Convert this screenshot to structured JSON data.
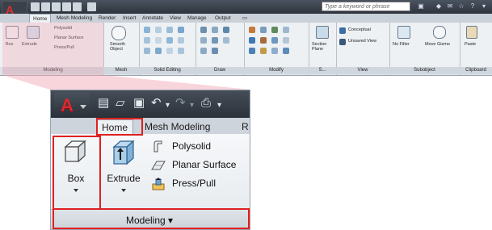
{
  "small_ribbon": {
    "search_placeholder": "Type a keyword or phrase",
    "tabs": [
      "Home",
      "Mesh Modeling",
      "Render",
      "Insert",
      "Annotate",
      "View",
      "Manage",
      "Output"
    ],
    "modeling": {
      "box": "Box",
      "extrude": "Extrude",
      "polysolid": "Polysolid",
      "planar": "Planar Surface",
      "presspull": "Press/Pull",
      "title": "Modeling"
    },
    "mesh": {
      "smooth": "Smooth Object",
      "title": "Mesh"
    },
    "solid_editing_title": "Solid Editing",
    "draw_title": "Draw",
    "modify_title": "Modify",
    "section": {
      "label": "Section Plane",
      "title": "S..."
    },
    "view": {
      "conceptual": "Conceptual",
      "unsaved": "Unsaved View",
      "title": "View"
    },
    "subobject": {
      "no_filter": "No Filter",
      "move_gizmo": "Move Gizmo",
      "title": "Subobject"
    },
    "clipboard": {
      "paste": "Paste",
      "title": "Clipboard"
    }
  },
  "zoom": {
    "tabs": {
      "home": "Home",
      "mesh": "Mesh Modeling",
      "third": "R"
    },
    "box_label": "Box",
    "extrude_label": "Extrude",
    "polysolid_label": "Polysolid",
    "planar_label": "Planar Surface",
    "presspull_label": "Press/Pull",
    "panel_title": "Modeling ▾"
  },
  "colors": {
    "highlight": "#e02020",
    "app_red": "#e0262f"
  },
  "icons": [
    "app-menu-icon",
    "new-icon",
    "open-icon",
    "save-icon",
    "undo-icon",
    "redo-icon",
    "print-icon",
    "box-icon",
    "extrude-icon",
    "polysolid-icon",
    "planar-surface-icon",
    "presspull-icon"
  ]
}
